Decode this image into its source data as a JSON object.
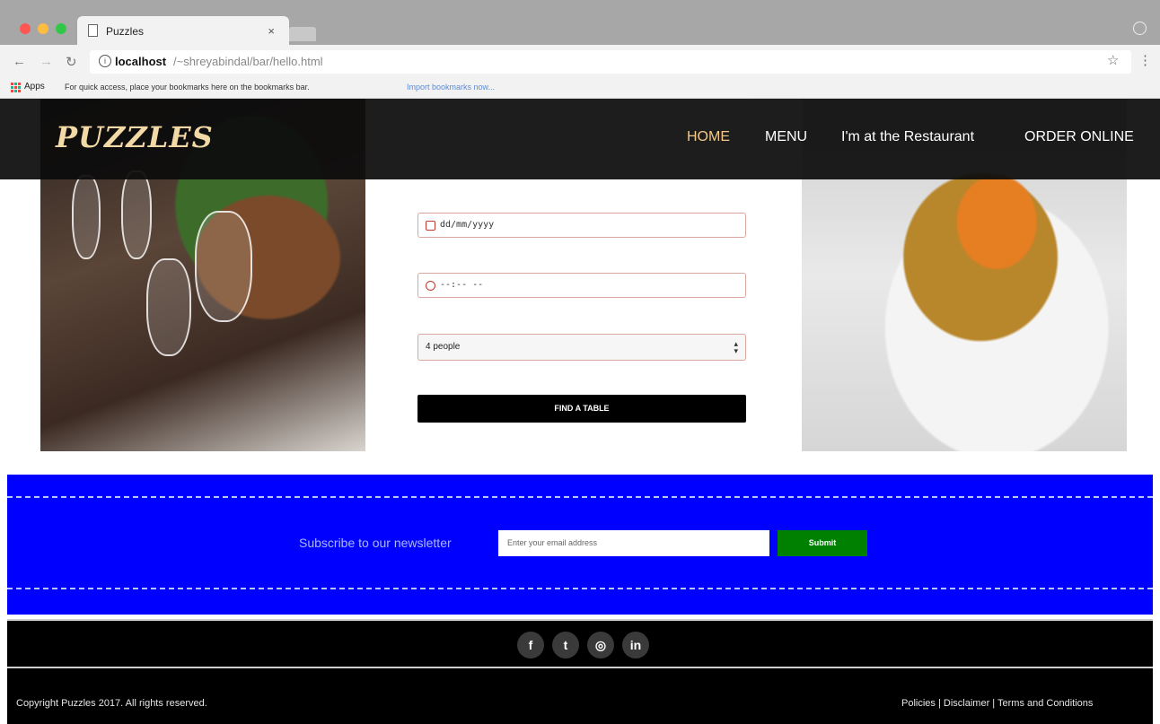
{
  "browser": {
    "tab_title": "Puzzles",
    "tab_close": "×",
    "url_host": "localhost",
    "url_path": "/~shreyabindal/bar/hello.html",
    "apps_label": "Apps",
    "bookmarks_hint": "For quick access, place your bookmarks here on the bookmarks bar.",
    "bookmarks_import": "Import bookmarks now..."
  },
  "header": {
    "logo": "PUZZLES",
    "nav": [
      {
        "label": "HOME",
        "active": true
      },
      {
        "label": "MENU"
      },
      {
        "label": "I'm at the Restaurant"
      },
      {
        "label": "ORDER ONLINE"
      }
    ],
    "accent": "#f3c98a"
  },
  "reservation": {
    "date_placeholder": "dd/mm/yyyy",
    "time_placeholder": "--:-- --",
    "people_value": "4 people",
    "find_button": "FIND A TABLE"
  },
  "newsletter": {
    "label": "Subscribe to our newsletter",
    "input_placeholder": "Enter your email address",
    "submit_label": "Submit",
    "bg_color": "#0000ff",
    "submit_color": "#008000"
  },
  "footer": {
    "social": [
      {
        "icon": "facebook-icon",
        "glyph": "f"
      },
      {
        "icon": "twitter-icon",
        "glyph": "t"
      },
      {
        "icon": "instagram-icon",
        "glyph": "◎"
      },
      {
        "icon": "linkedin-icon",
        "glyph": "in"
      }
    ],
    "copyright": "Copyright Puzzles 2017. All rights reserved.",
    "links": [
      "Policies",
      "Disclaimer",
      "Terms and Conditions"
    ],
    "separator": "|"
  }
}
